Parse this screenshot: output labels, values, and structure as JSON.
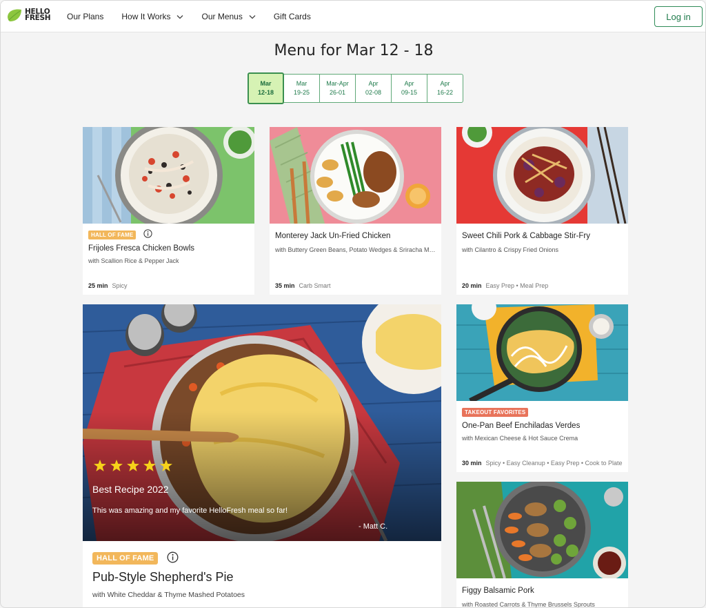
{
  "header": {
    "logo_text_line1": "HELLO",
    "logo_text_line2": "FRESH",
    "nav": [
      "Our Plans",
      "How It Works",
      "Our Menus",
      "Gift Cards"
    ],
    "login_label": "Log in"
  },
  "menu": {
    "title": "Menu for Mar 12 - 18",
    "weeks": [
      {
        "month": "Mar",
        "days": "12-18"
      },
      {
        "month": "Mar",
        "days": "19-25"
      },
      {
        "month": "Mar-Apr",
        "days": "26-01"
      },
      {
        "month": "Apr",
        "days": "02-08"
      },
      {
        "month": "Apr",
        "days": "09-15"
      },
      {
        "month": "Apr",
        "days": "16-22"
      }
    ]
  },
  "recipes": [
    {
      "badge": "HALL OF FAME",
      "title": "Frijoles Fresca Chicken Bowls",
      "subtitle": "with Scallion Rice & Pepper Jack",
      "time": "25 min",
      "tags": "Spicy"
    },
    {
      "title": "Monterey Jack Un-Fried Chicken",
      "subtitle": "with Buttery Green Beans, Potato Wedges & Sriracha Mayo",
      "time": "35 min",
      "tags": "Carb Smart"
    },
    {
      "title": "Sweet Chili Pork & Cabbage Stir-Fry",
      "subtitle": "with Cilantro & Crispy Fried Onions",
      "time": "20 min",
      "tags": "Easy Prep • Meal Prep"
    },
    {
      "badge": "TAKEOUT FAVORITES",
      "title": "One-Pan Beef Enchiladas Verdes",
      "subtitle": "with Mexican Cheese & Hot Sauce Crema",
      "time": "30 min",
      "tags": "Spicy • Easy Cleanup • Easy Prep • Cook to Plate"
    },
    {
      "title": "Figgy Balsamic Pork",
      "subtitle": "with Roasted Carrots & Thyme Brussels Sprouts"
    }
  ],
  "featured": {
    "rating": 5,
    "review_title": "Best Recipe 2022",
    "review_text": "This was amazing and my favorite HelloFresh meal so far!",
    "review_author": "- Matt C.",
    "badge": "HALL OF FAME",
    "title": "Pub-Style Shepherd's Pie",
    "subtitle": "with White Cheddar & Thyme Mashed Potatoes"
  },
  "colors": {
    "brand_green": "#1e7a4a",
    "active_week_bg": "#d6f2b4",
    "hall_of_fame": "#f2b75b",
    "takeout": "#e8735a",
    "star": "#f6d21a"
  }
}
